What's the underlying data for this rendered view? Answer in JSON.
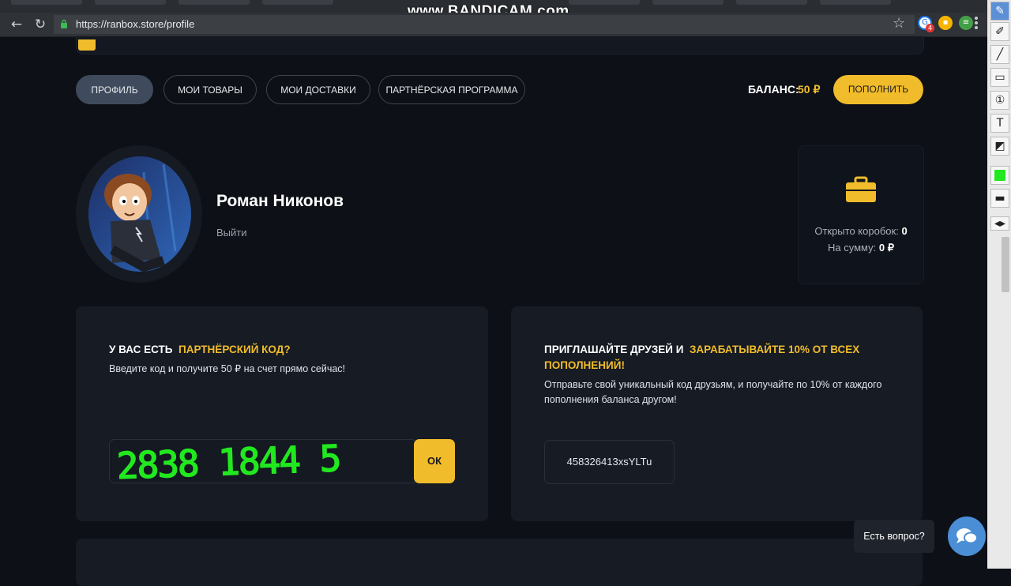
{
  "browser": {
    "url": "https://ranbox.store/profile",
    "watermark": "www.BANDICAM.com",
    "extension_badge": "4"
  },
  "nav": {
    "tabs": [
      {
        "label": "ПРОФИЛЬ",
        "active": true
      },
      {
        "label": "МОИ ТОВАРЫ",
        "active": false
      },
      {
        "label": "МОИ ДОСТАВКИ",
        "active": false
      },
      {
        "label": "ПАРТНЁРСКАЯ ПРОГРАММА",
        "active": false
      }
    ],
    "balance_label": "БАЛАНС:",
    "balance_value": "50 ₽",
    "topup_label": "ПОПОЛНИТЬ"
  },
  "profile": {
    "name": "Роман Никонов",
    "logout": "Выйти"
  },
  "stats": {
    "opened_label": "Открыто коробок:",
    "opened_value": "0",
    "sum_label": "На сумму:",
    "sum_value": "0 ₽"
  },
  "partner_code_card": {
    "title_prefix": "У ВАС ЕСТЬ",
    "title_highlight": "ПАРТНЁРСКИЙ КОД?",
    "description": "Введите код и получите 50 ₽  на счет прямо сейчас!",
    "input_value": "",
    "scribble_text": "2838 1844 5",
    "ok_label": "ОК"
  },
  "invite_card": {
    "title_prefix": "ПРИГЛАШАЙТЕ ДРУЗЕЙ И",
    "title_highlight_1": "ЗАРАБАТЫВАЙТЕ 10% ОТ ВСЕХ",
    "title_highlight_2": "ПОПОЛНЕНИЙ!",
    "description_1": "Отправьте свой уникальный код друзьям, и получайте по 10% от каждого",
    "description_2": "пополнения баланса другом!",
    "referral_code": "458326413xsYLTu"
  },
  "help": {
    "label": "Есть вопрос?"
  },
  "colors": {
    "background": "#0d1016",
    "card": "#161b24",
    "accent": "#f1bc2b",
    "active_pill": "#3f4b5c",
    "chat": "#4a8ed6",
    "marker": "#22e81f"
  }
}
